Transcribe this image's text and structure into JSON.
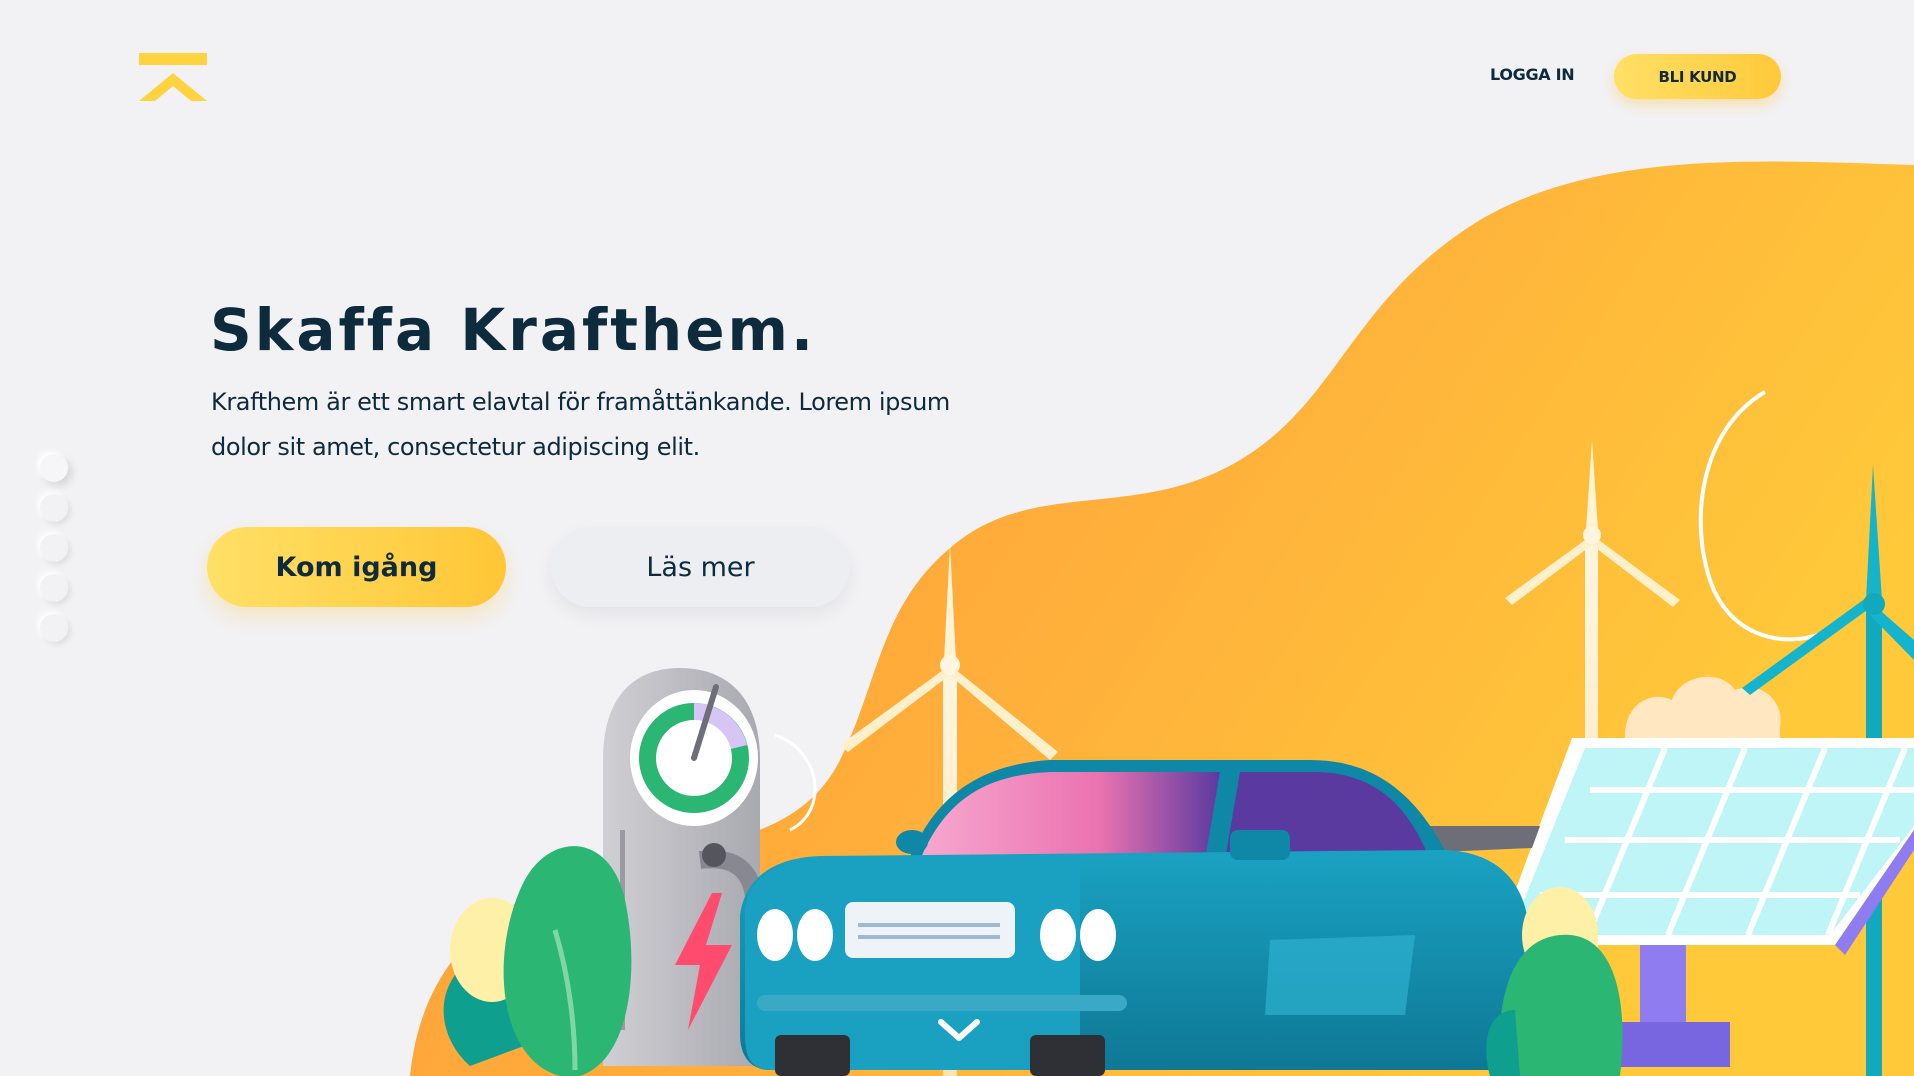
{
  "brand": {
    "logo_icon": "krafthem-logo-icon",
    "accent": "#ffd23f"
  },
  "nav": {
    "login_label": "LOGGA IN",
    "signup_label": "BLI KUND"
  },
  "hero": {
    "title": "Skaffa Krafthem.",
    "text": "Krafthem är ett smart elavtal för framåttänkande. Lorem ipsum dolor sit amet, consectetur adipiscing elit.",
    "primary_label": "Kom igång",
    "secondary_label": "Läs mer"
  },
  "pager": {
    "count": 5,
    "active_index": 0
  },
  "colors": {
    "background": "#f2f2f5",
    "blob_orange": "#ffa63a",
    "blob_yellow": "#ffc93a",
    "text_dark": "#0e2a3d",
    "car_teal": "#1592b3",
    "car_pink": "#ee7ab4",
    "leaf_green": "#2bb673",
    "turbine_cyan": "#14b5cc"
  },
  "illustration": {
    "icons": [
      "charging-station-icon",
      "electric-car-icon",
      "wind-turbine-icon",
      "solar-panel-icon",
      "bush-icon",
      "lightning-icon",
      "scroll-down-chevron-icon"
    ]
  }
}
